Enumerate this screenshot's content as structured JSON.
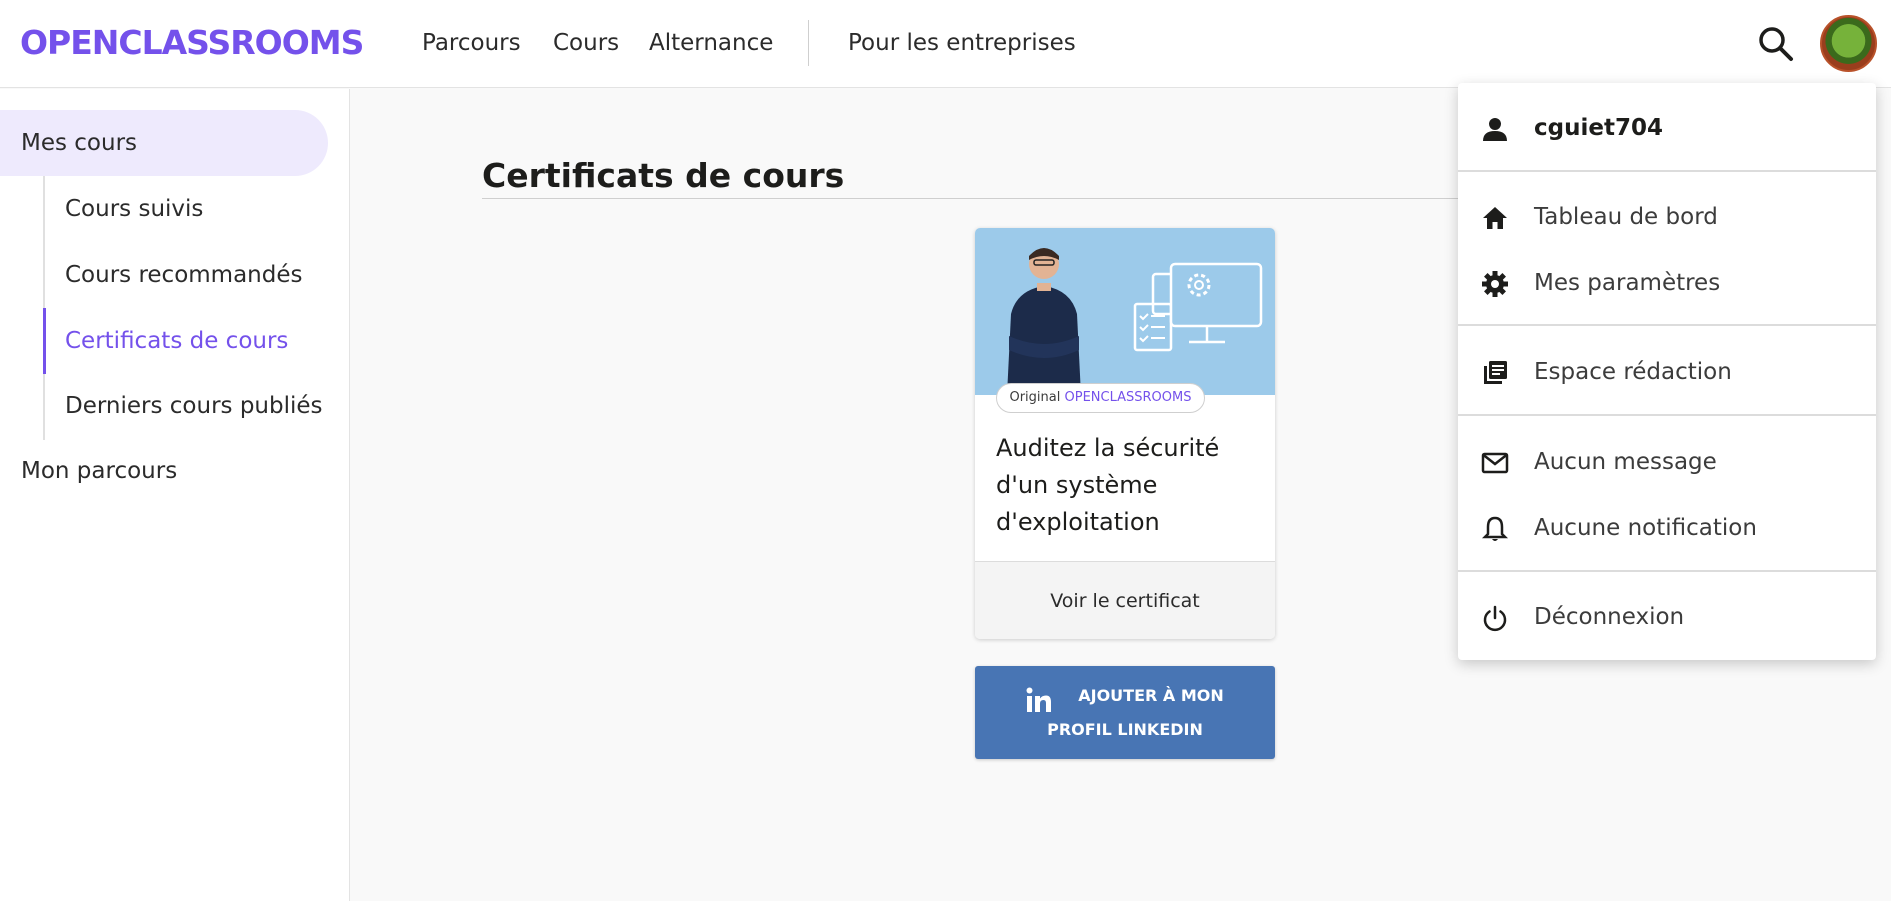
{
  "header": {
    "logo": "OPENCLASSROOMS",
    "nav": [
      "Parcours",
      "Cours",
      "Alternance",
      "Pour les entreprises"
    ]
  },
  "sidebar": {
    "main": "Mes cours",
    "sub": [
      "Cours suivis",
      "Cours recommandés",
      "Certificats de cours",
      "Derniers cours publiés"
    ],
    "active_sub": "Certificats de cours",
    "footer": "Mon parcours"
  },
  "main": {
    "title": "Certificats de cours",
    "card": {
      "badge_prefix": "Original",
      "badge_brand": "OPENCLASSROOMS",
      "title": "Auditez la sécurité d'un système d'exploitation",
      "action": "Voir le certificat"
    },
    "linkedin": {
      "line1": "AJOUTER À MON",
      "line2": "PROFIL LINKEDIN"
    }
  },
  "user_menu": {
    "username": "cguiet704",
    "items": [
      "Tableau de bord",
      "Mes paramètres",
      "Espace rédaction",
      "Aucun message",
      "Aucune notification",
      "Déconnexion"
    ]
  },
  "colors": {
    "brand": "#7451eb",
    "linkedin": "#4875b4"
  }
}
